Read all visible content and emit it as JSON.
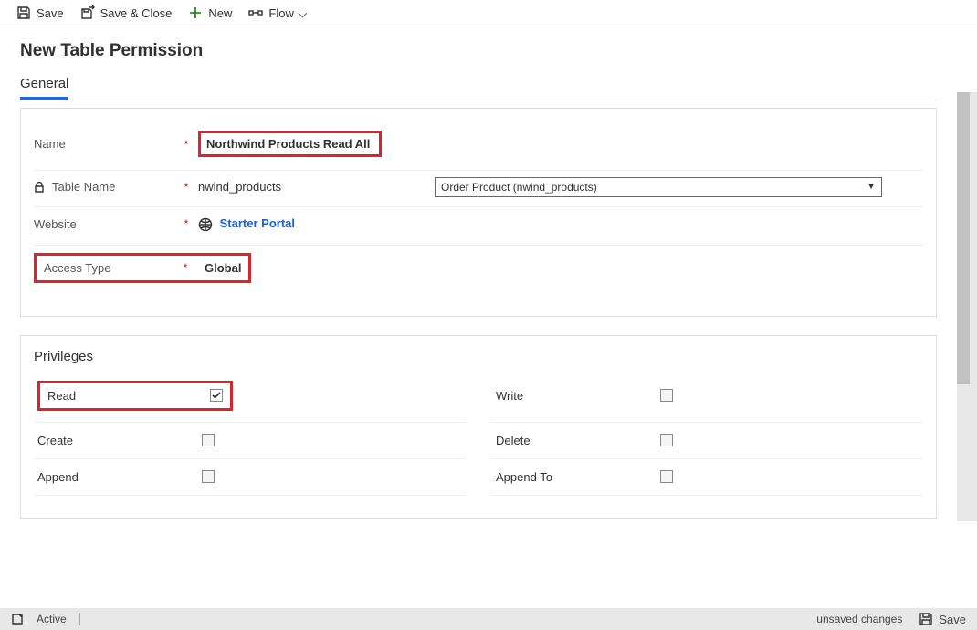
{
  "toolbar": {
    "save": "Save",
    "save_close": "Save & Close",
    "new": "New",
    "flow": "Flow"
  },
  "page_title": "New Table Permission",
  "tab_general": "General",
  "fields": {
    "name_label": "Name",
    "name_value": "Northwind Products Read All",
    "table_label": "Table Name",
    "table_value": "nwind_products",
    "website_label": "Website",
    "website_value": "Starter Portal",
    "access_label": "Access Type",
    "access_value": "Global",
    "dropdown_value": "Order Product (nwind_products)"
  },
  "privileges": {
    "heading": "Privileges",
    "read": "Read",
    "write": "Write",
    "create": "Create",
    "delete": "Delete",
    "append": "Append",
    "append_to": "Append To",
    "read_checked": true
  },
  "status": {
    "active": "Active",
    "unsaved": "unsaved changes",
    "save": "Save"
  }
}
